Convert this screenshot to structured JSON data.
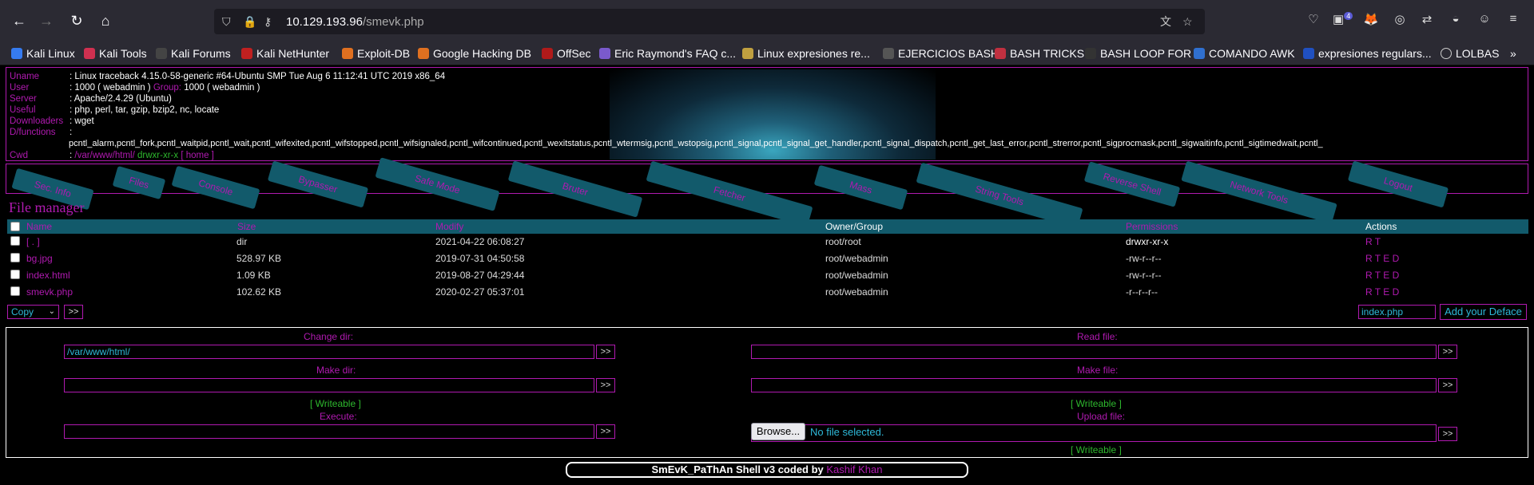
{
  "browser": {
    "url_host": "10.129.193.96",
    "url_path": "/smevk.php",
    "bookmarks": [
      "Kali Linux",
      "Kali Tools",
      "Kali Forums",
      "Kali NetHunter",
      "Exploit-DB",
      "Google Hacking DB",
      "OffSec",
      "Eric Raymond's FAQ c...",
      "Linux expresiones re...",
      "EJERCICIOS BASH",
      "BASH TRICKS",
      "BASH LOOP FOR",
      "COMANDO AWK",
      "expresiones regulars...",
      "LOLBAS"
    ],
    "badge": "4"
  },
  "info": {
    "uname_label": "Uname",
    "uname": "Linux traceback 4.15.0-58-generic #64-Ubuntu SMP Tue Aug 6 11:12:41 UTC 2019 x86_64",
    "user_label": "User",
    "user_id": "1000 ( webadmin )",
    "group_label": "Group:",
    "group_id": "1000 ( webadmin )",
    "server_label": "Server",
    "server": "Apache/2.4.29 (Ubuntu)",
    "useful_label": "Useful",
    "useful": "php, perl, tar, gzip, bzip2, nc, locate",
    "downloaders_label": "Downloaders",
    "downloaders": "wget",
    "dfunctions_label": "D/functions",
    "dfunctions": "pcntl_alarm,pcntl_fork,pcntl_waitpid,pcntl_wait,pcntl_wifexited,pcntl_wifstopped,pcntl_wifsignaled,pcntl_wifcontinued,pcntl_wexitstatus,pcntl_wtermsig,pcntl_wstopsig,pcntl_signal,pcntl_signal_get_handler,pcntl_signal_dispatch,pcntl_get_last_error,pcntl_strerror,pcntl_sigprocmask,pcntl_sigwaitinfo,pcntl_sigtimedwait,pcntl_",
    "cwd_label": "Cwd",
    "cwd": "/var/www/html/",
    "cwd_perm": "drwxr-xr-x",
    "home": "[ home ]"
  },
  "menu": [
    "Sec. Info",
    "Files",
    "Console",
    "Bypasser",
    "Safe Mode",
    "Bruter",
    "Fetcher",
    "Mass",
    "String Tools",
    "Reverse Shell",
    "Network Tools",
    "Logout"
  ],
  "file_manager": {
    "title": "File manager",
    "headers": [
      "Name",
      "Size",
      "Modify",
      "Owner/Group",
      "Permissions",
      "Actions"
    ],
    "rows": [
      {
        "name": "[ . ]",
        "size": "dir",
        "modify": "2021-04-22 06:08:27",
        "owner": "root/root",
        "perm": "drwxr-xr-x",
        "actions": "R T"
      },
      {
        "name": "bg.jpg",
        "size": "528.97 KB",
        "modify": "2019-07-31 04:50:58",
        "owner": "root/webadmin",
        "perm": "-rw-r--r--",
        "actions": "R T E D"
      },
      {
        "name": "index.html",
        "size": "1.09 KB",
        "modify": "2019-08-27 04:29:44",
        "owner": "root/webadmin",
        "perm": "-rw-r--r--",
        "actions": "R T E D"
      },
      {
        "name": "smevk.php",
        "size": "102.62 KB",
        "modify": "2020-02-27 05:37:01",
        "owner": "root/webadmin",
        "perm": "-r--r--r--",
        "actions": "R T E D"
      }
    ],
    "bulk_action": "Copy",
    "go": ">>",
    "deface_file": "index.php",
    "deface_button": "Add your Deface"
  },
  "tools": {
    "change_dir": "Change dir:",
    "change_dir_value": "/var/www/html/",
    "read_file": "Read file:",
    "make_dir": "Make dir:",
    "make_file": "Make file:",
    "writeable": "[ Writeable ]",
    "execute": "Execute:",
    "upload_file": "Upload file:",
    "browse": "Browse...",
    "no_file": "No file selected."
  },
  "footer": {
    "text": "SmEvK_PaThAn Shell v3 coded by ",
    "author": "Kashif Khan"
  }
}
